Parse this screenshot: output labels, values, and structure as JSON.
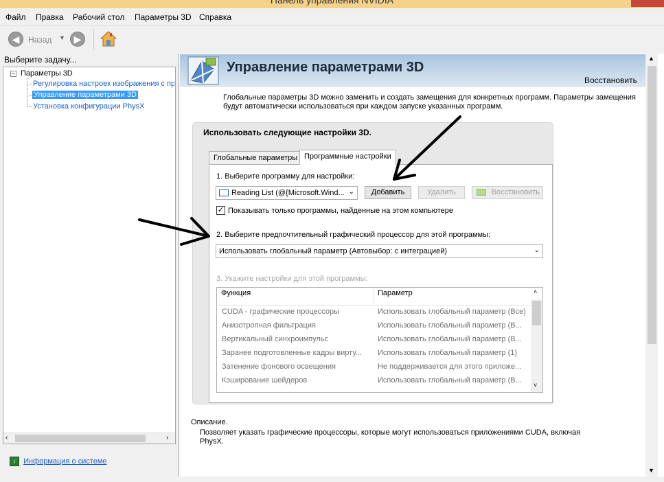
{
  "window": {
    "title": "Панель управления NVIDIA"
  },
  "menu": [
    "Файл",
    "Правка",
    "Рабочий стол",
    "Параметры 3D",
    "Справка"
  ],
  "toolbar": {
    "back_label": "Назад"
  },
  "left": {
    "header": "Выберите задачу...",
    "root": "Параметры 3D",
    "items": [
      "Регулировка настроек изображения с пр",
      "Управление параметрами 3D",
      "Установка конфигурации PhysX"
    ],
    "system_info": "Информация о системе"
  },
  "main": {
    "title": "Управление параметрами 3D",
    "restore_link": "Восстановить",
    "intro": "Глобальные параметры 3D можно заменить и создать замещения для конкретных программ. Параметры замещения будут автоматически использоваться при каждом запуске указанных программ.",
    "box_title": "Использовать следующие настройки 3D.",
    "tabs": [
      "Глобальные параметры",
      "Программные настройки"
    ],
    "step1": "1. Выберите программу для настройки:",
    "program_value": "Reading List (@{Microsoft.Wind...",
    "add_button": "Добавить",
    "remove_button": "Удалить",
    "restore_button": "Восстановить",
    "show_only": "Показывать только программы, найденные на этом компьютере",
    "show_only_checked": true,
    "step2": "2. Выберите предпочтительный графический процессор для этой программы:",
    "gpu_value": "Использовать глобальный параметр (Автовыбор: с интеграцией)",
    "step3": "3. Укажите настройки для этой программы:",
    "table": {
      "headers": [
        "Функция",
        "Параметр"
      ],
      "rows": [
        [
          "CUDA - графические процессоры",
          "Использовать глобальный параметр (Все)"
        ],
        [
          "Анизотропная фильтрация",
          "Использовать глобальный параметр (В..."
        ],
        [
          "Вертикальный синхроимпульс",
          "Использовать глобальный параметр (В..."
        ],
        [
          "Заранее подготовленные кадры вирту...",
          "Использовать глобальный параметр (1)"
        ],
        [
          "Затенение фонового освещения",
          "Не поддерживается для этого приложе..."
        ],
        [
          "Кэширование шейдеров",
          "Использовать глобальный параметр (В..."
        ]
      ]
    },
    "description_label": "Описание.",
    "description": "Позволяет указать графические процессоры, которые могут использоваться приложениями CUDA, включая PhysX."
  },
  "icons": [
    "back-icon",
    "forward-icon",
    "home-icon",
    "nvidia-3d-icon",
    "system-info-icon",
    "nvidia-logo-icon"
  ]
}
